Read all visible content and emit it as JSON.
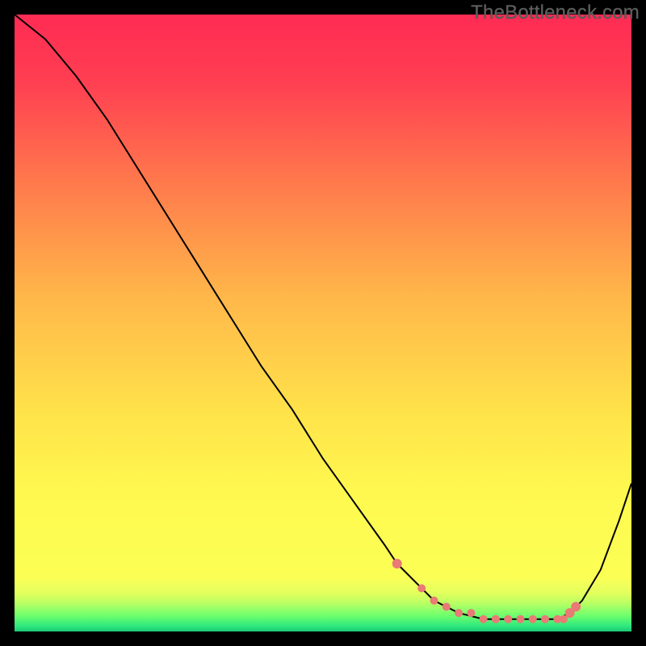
{
  "watermark": "TheBottleneck.com",
  "chart_data": {
    "type": "line",
    "title": "",
    "xlabel": "",
    "ylabel": "",
    "xlim": [
      0,
      100
    ],
    "ylim": [
      0,
      100
    ],
    "background_gradient": [
      "#ff2d55",
      "#ff5a4e",
      "#ffb24a",
      "#ffe94a",
      "#f7ff59",
      "#8cff6a",
      "#22d877"
    ],
    "series": [
      {
        "name": "bottleneck-curve",
        "color": "#000000",
        "x": [
          0,
          5,
          10,
          15,
          20,
          25,
          30,
          35,
          40,
          45,
          50,
          55,
          60,
          62,
          68,
          72,
          76,
          80,
          84,
          88,
          90,
          92,
          95,
          98,
          100
        ],
        "values": [
          100,
          96,
          90,
          83,
          75,
          67,
          59,
          51,
          43,
          36,
          28,
          21,
          14,
          11,
          5,
          3,
          2,
          2,
          2,
          2,
          3,
          5,
          10,
          18,
          24
        ]
      }
    ],
    "markers": {
      "name": "highlighted-range",
      "color": "#e97a75",
      "x": [
        62,
        66,
        68,
        70,
        72,
        74,
        76,
        78,
        80,
        82,
        84,
        86,
        88,
        89,
        90,
        91
      ],
      "values": [
        11,
        7,
        5,
        4,
        3,
        3,
        2,
        2,
        2,
        2,
        2,
        2,
        2,
        2,
        3,
        4
      ]
    }
  }
}
